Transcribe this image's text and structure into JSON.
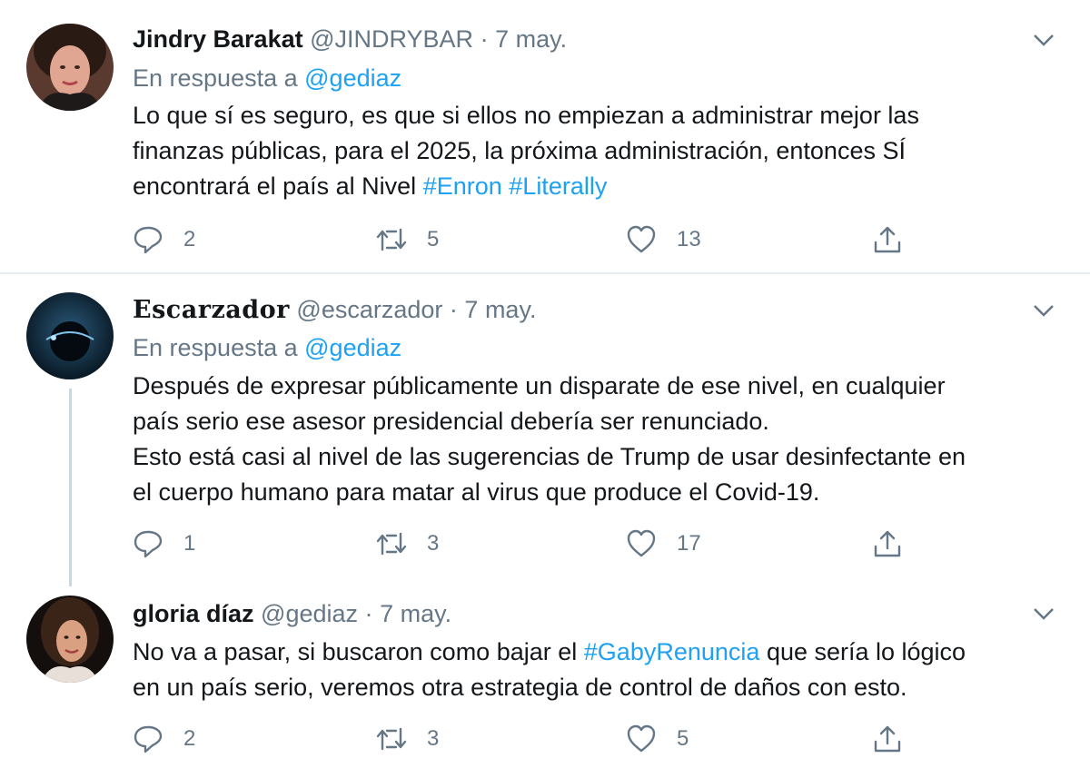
{
  "tweets": [
    {
      "name": "Jindry Barakat",
      "handle": "@JINDRYBAR",
      "separator": "·",
      "date": "7 may.",
      "reply_prefix": "En respuesta a",
      "reply_mention": "@gediaz",
      "text_lines": [
        "Lo que sí es seguro, es que si ellos no empiezan a administrar mejor las",
        "finanzas públicas, para el 2025, la próxima administración, entonces SÍ",
        "encontrará el país al Nivel"
      ],
      "hashtags": [
        "#Enron",
        "#Literally"
      ],
      "replies": "2",
      "retweets": "5",
      "likes": "13"
    },
    {
      "name": "Escarzador",
      "handle": "@escarzador",
      "separator": "·",
      "date": "7 may.",
      "reply_prefix": "En respuesta a",
      "reply_mention": "@gediaz",
      "text_lines": [
        "Después de expresar públicamente un disparate de ese nivel, en cualquier",
        "país serio ese asesor presidencial debería ser renunciado.",
        "Esto está casi al nivel de las sugerencias de Trump de usar desinfectante en",
        "el cuerpo humano para matar al virus que produce el Covid-19."
      ],
      "replies": "1",
      "retweets": "3",
      "likes": "17"
    },
    {
      "name": "gloria díaz",
      "handle": "@gediaz",
      "separator": "·",
      "date": "7 may.",
      "text_line1_before": "No va a pasar, si buscaron como bajar el",
      "text_line1_hashtag": "#GabyRenuncia",
      "text_line1_after": "que sería lo lógico",
      "text_line2": "en un país serio, veremos otra estrategia de control de daños con esto.",
      "replies": "2",
      "retweets": "3",
      "likes": "5"
    }
  ],
  "icons": {
    "reply": "reply-icon",
    "retweet": "retweet-icon",
    "like": "heart-icon",
    "share": "share-icon",
    "more": "chevron-down-icon"
  },
  "colors": {
    "link": "#1da1f2",
    "secondary_text": "#657786",
    "divider": "#e6ecf0"
  }
}
